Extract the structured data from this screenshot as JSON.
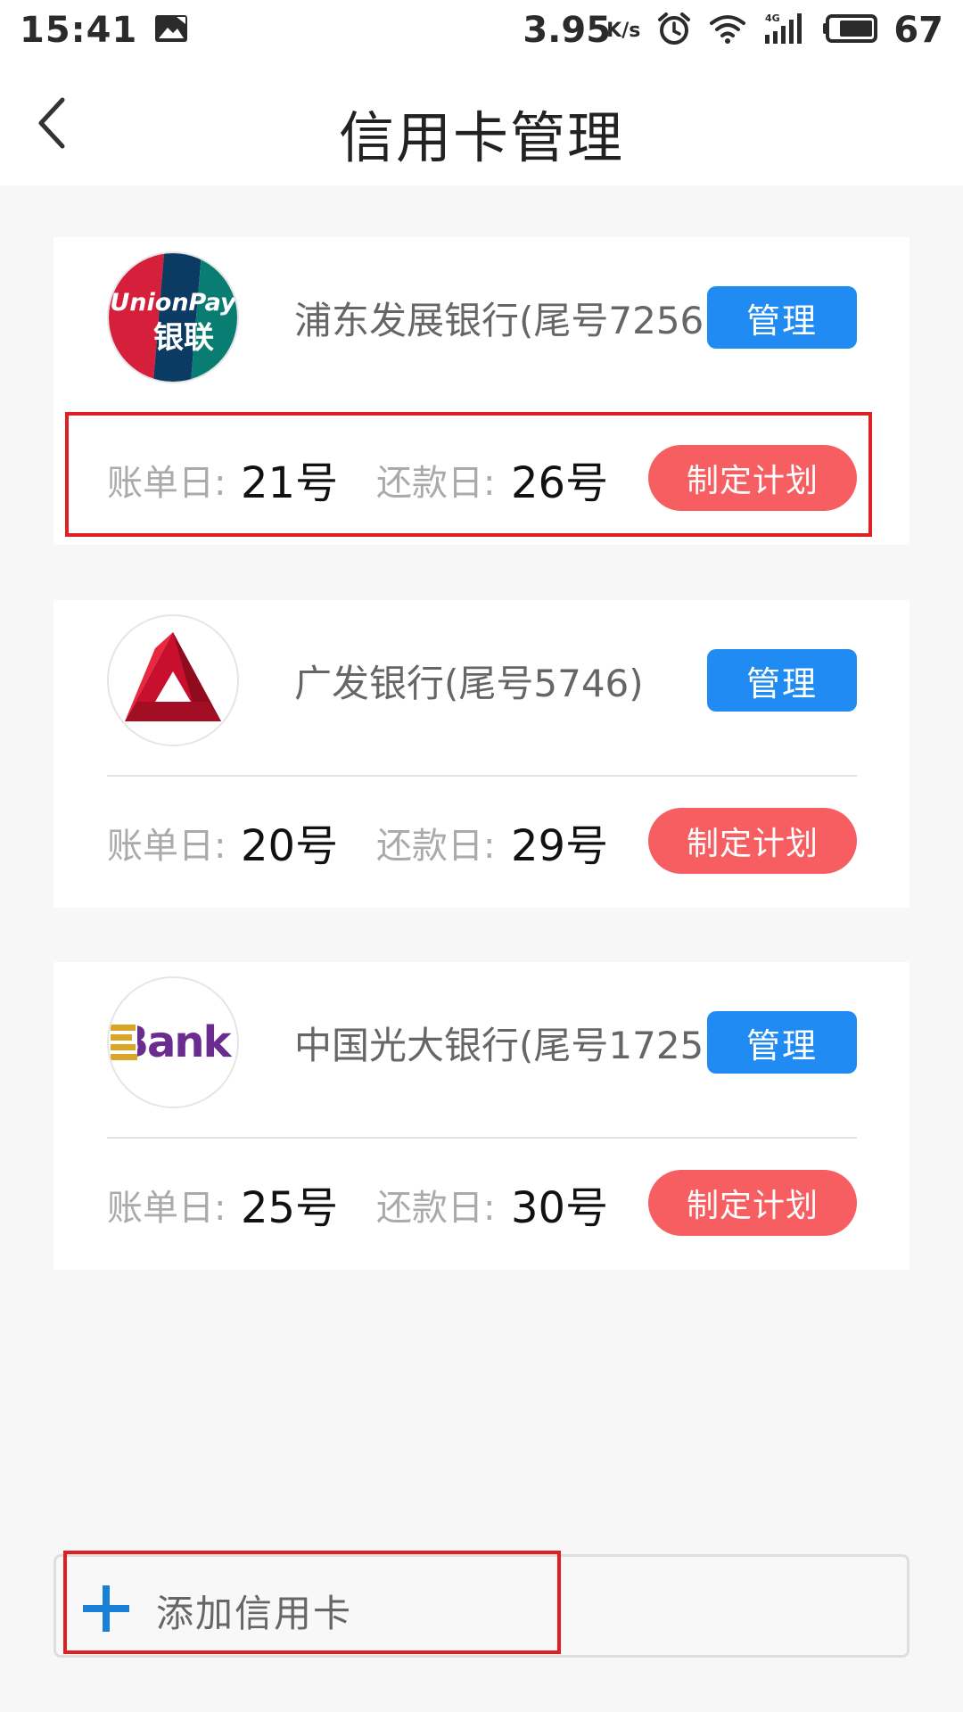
{
  "status_bar": {
    "time": "15:41",
    "speed": "3.95",
    "speed_unit": "K/s",
    "battery": "67",
    "icons": [
      "image-icon",
      "alarm-icon",
      "wifi-icon",
      "signal-4g-icon",
      "battery-icon"
    ]
  },
  "header": {
    "title": "信用卡管理",
    "back_icon": "back-arrow-icon"
  },
  "cards": [
    {
      "bank_name": "浦东发展银行(尾号7256)",
      "logo": "unionpay-logo",
      "logo_text_top": "UnionPay",
      "logo_text_bottom": "银联",
      "manage_label": "管理",
      "bill_day_label": "账单日:",
      "bill_day_value": "21号",
      "repay_day_label": "还款日:",
      "repay_day_value": "26号",
      "plan_label": "制定计划"
    },
    {
      "bank_name": "广发银行(尾号5746)",
      "logo": "cgb-logo",
      "manage_label": "管理",
      "bill_day_label": "账单日:",
      "bill_day_value": "20号",
      "repay_day_label": "还款日:",
      "repay_day_value": "29号",
      "plan_label": "制定计划"
    },
    {
      "bank_name": "中国光大银行(尾号1725)",
      "logo": "bank-logo",
      "logo_text": "Bank",
      "manage_label": "管理",
      "bill_day_label": "账单日:",
      "bill_day_value": "25号",
      "repay_day_label": "还款日:",
      "repay_day_value": "30号",
      "plan_label": "制定计划"
    }
  ],
  "add_card": {
    "label": "添加信用卡",
    "icon": "plus-icon"
  },
  "colors": {
    "manage_button": "#1f8bf3",
    "plan_button": "#f75e62",
    "highlight": "#e02020",
    "plus_icon": "#1a7fd6",
    "background": "#f7f7f7"
  }
}
